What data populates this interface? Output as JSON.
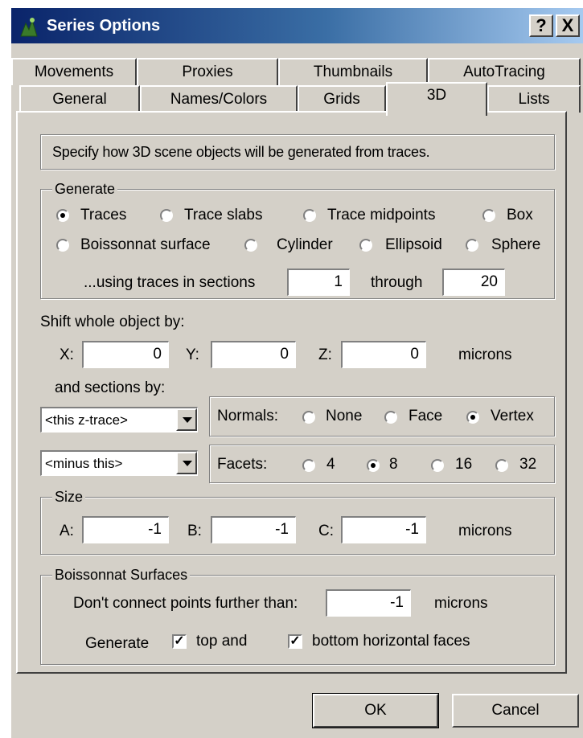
{
  "window": {
    "title": "Series Options",
    "help_label": "?",
    "close_label": "X"
  },
  "tabs": {
    "row1": [
      "Movements",
      "Proxies",
      "Thumbnails",
      "AutoTracing"
    ],
    "row2": [
      "General",
      "Names/Colors",
      "Grids",
      "3D",
      "Lists"
    ],
    "active": "3D"
  },
  "description": "Specify how 3D scene objects will be generated from traces.",
  "generate": {
    "legend": "Generate",
    "options": [
      "Traces",
      "Trace slabs",
      "Trace midpoints",
      "Box",
      "Boissonnat surface",
      "Cylinder",
      "Ellipsoid",
      "Sphere"
    ],
    "selected": "Traces",
    "range_label": "...using traces in sections",
    "from": "1",
    "through_label": "through",
    "to": "20"
  },
  "shift": {
    "label": "Shift whole object by:",
    "x_label": "X:",
    "x": "0",
    "y_label": "Y:",
    "y": "0",
    "z_label": "Z:",
    "z": "0",
    "units": "microns",
    "sections_label": "and sections by:",
    "combo1": "<this z-trace>",
    "combo2": "<minus this>"
  },
  "normals": {
    "label": "Normals:",
    "options": [
      "None",
      "Face",
      "Vertex"
    ],
    "selected": "Vertex"
  },
  "facets": {
    "label": "Facets:",
    "options": [
      "4",
      "8",
      "16",
      "32"
    ],
    "selected": "8"
  },
  "size": {
    "legend": "Size",
    "a_label": "A:",
    "a": "-1",
    "b_label": "B:",
    "b": "-1",
    "c_label": "C:",
    "c": "-1",
    "units": "microns"
  },
  "boissonnat": {
    "legend": "Boissonnat Surfaces",
    "connect_label": "Don't connect points further than:",
    "connect_value": "-1",
    "units": "microns",
    "generate_label": "Generate",
    "top_label": "top and",
    "top_checked": true,
    "bottom_label": "bottom horizontal faces",
    "bottom_checked": true
  },
  "buttons": {
    "ok": "OK",
    "cancel": "Cancel"
  },
  "colors": {
    "titlebar": "#0a246a",
    "face": "#d4d0c8"
  }
}
